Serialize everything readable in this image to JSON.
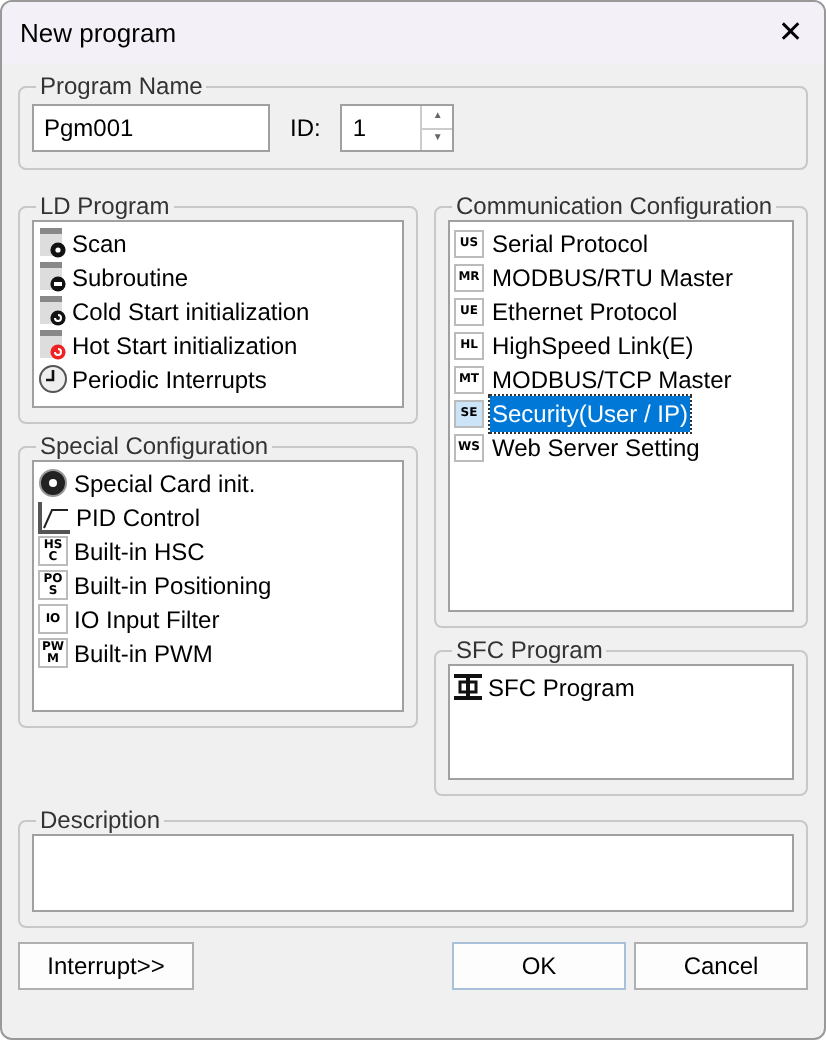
{
  "window": {
    "title": "New program",
    "close": "✕"
  },
  "program_name": {
    "label": "Program Name",
    "value": "Pgm001",
    "id_label": "ID:",
    "id_value": "1",
    "up": "▲",
    "down": "▼"
  },
  "ld_program": {
    "label": "LD Program",
    "items": [
      {
        "kind": "scan",
        "label": "Scan"
      },
      {
        "kind": "subroutine",
        "label": "Subroutine"
      },
      {
        "kind": "cold",
        "label": "Cold Start initialization"
      },
      {
        "kind": "hot",
        "label": "Hot Start initialization"
      },
      {
        "kind": "periodic",
        "label": "Periodic Interrupts"
      }
    ]
  },
  "special_configuration": {
    "label": "Special Configuration",
    "items": [
      {
        "kind": "card",
        "label": "Special Card init."
      },
      {
        "kind": "pid",
        "label": "PID Control"
      },
      {
        "kind": "letters",
        "icon": "HSC",
        "label": "Built-in HSC"
      },
      {
        "kind": "letters",
        "icon": "POS",
        "label": "Built-in Positioning"
      },
      {
        "kind": "letters",
        "icon": "IO",
        "label": "IO Input Filter"
      },
      {
        "kind": "letters",
        "icon": "PWM",
        "label": "Built-in PWM"
      }
    ]
  },
  "communication_configuration": {
    "label": "Communication Configuration",
    "items": [
      {
        "icon": "US",
        "label": "Serial Protocol",
        "selected": false
      },
      {
        "icon": "MR",
        "label": "MODBUS/RTU Master",
        "selected": false
      },
      {
        "icon": "UE",
        "label": "Ethernet Protocol",
        "selected": false
      },
      {
        "icon": "HL",
        "label": "HighSpeed Link(E)",
        "selected": false
      },
      {
        "icon": "MT",
        "label": "MODBUS/TCP Master",
        "selected": false
      },
      {
        "icon": "SE",
        "label": "Security(User / IP)",
        "selected": true
      },
      {
        "icon": "WS",
        "label": "Web Server Setting",
        "selected": false
      }
    ]
  },
  "sfc_program": {
    "label": "SFC Program",
    "items": [
      {
        "label": "SFC Program"
      }
    ]
  },
  "description": {
    "label": "Description"
  },
  "buttons": [
    {
      "label": "Interrupt>>",
      "kind": "secondary"
    },
    {
      "label": "OK",
      "kind": "default"
    },
    {
      "label": "Cancel",
      "kind": "secondary"
    }
  ]
}
